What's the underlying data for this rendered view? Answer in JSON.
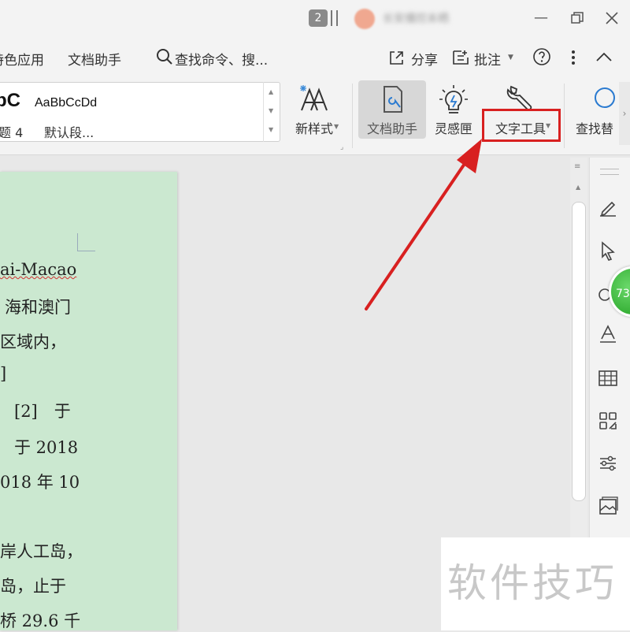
{
  "titlebar": {
    "tab_count": "2",
    "username": "长安播控未晒"
  },
  "menubar": {
    "items": [
      {
        "label": "特色应用"
      },
      {
        "label": "文档助手"
      }
    ],
    "search_placeholder": "查找命令、搜...",
    "share_label": "分享",
    "comment_label": "批注"
  },
  "ribbon": {
    "style_gallery": {
      "sample_heading": "bC",
      "sample_normal": "AaBbCcDd",
      "caption_heading": "题 4",
      "caption_normal": "默认段..."
    },
    "new_style_label": "新样式",
    "doc_helper_label": "文档助手",
    "inspiration_label": "灵感匣",
    "text_tools_label": "文字工具",
    "find_label": "查找替"
  },
  "document": {
    "lines": [
      "ai-Macao",
      "海和澳门",
      "区域内，",
      "]",
      "[2]　于",
      "于 2018",
      "018 年 10",
      "",
      "岸人工岛，",
      "岛，止于",
      "桥 29.6 千"
    ]
  },
  "sidebar": {
    "badge_text": "73"
  },
  "watermark": {
    "text": "软件技巧"
  },
  "colors": {
    "highlight": "#d82020",
    "arrow": "#d82020",
    "page_bg": "#cbe8d0"
  }
}
